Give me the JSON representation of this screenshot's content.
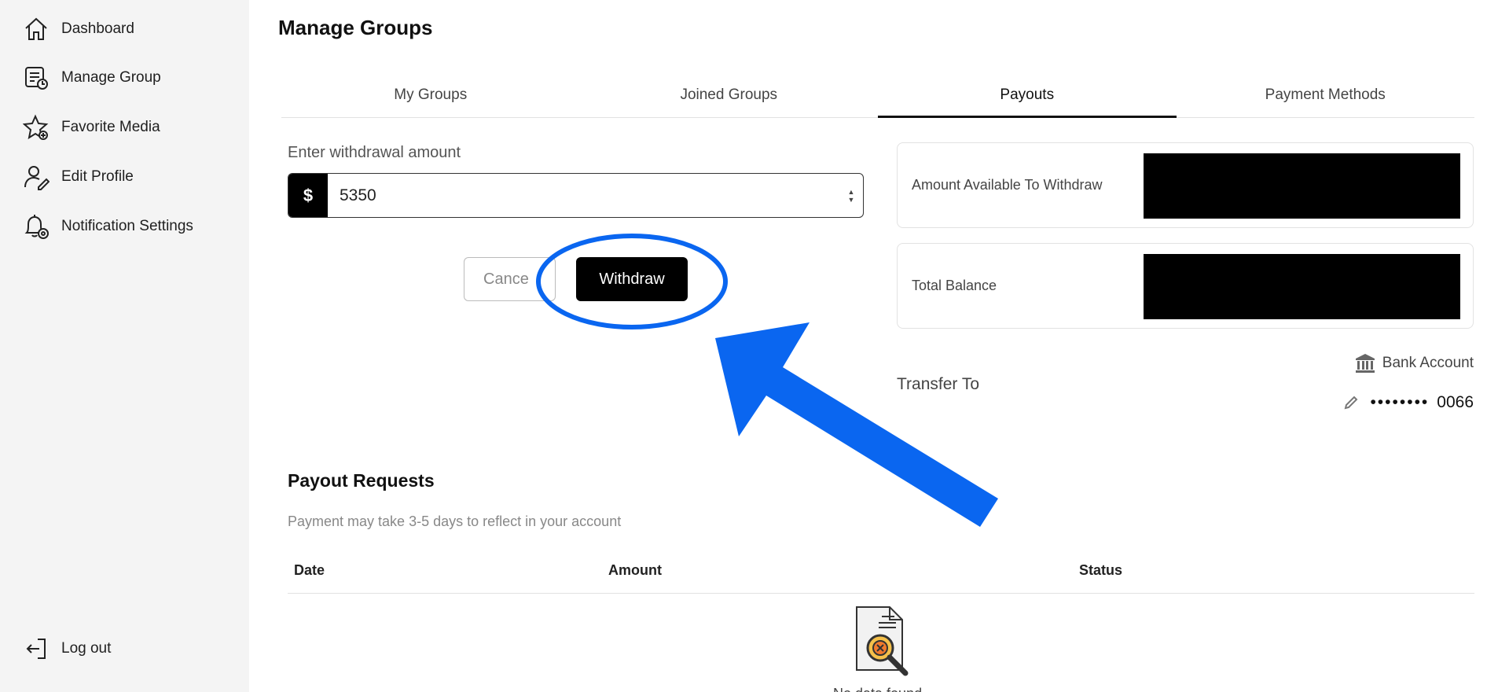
{
  "sidebar": {
    "items": [
      {
        "label": "Dashboard",
        "icon": "home-icon"
      },
      {
        "label": "Manage Group",
        "icon": "manage-group-icon"
      },
      {
        "label": "Favorite Media",
        "icon": "star-icon"
      },
      {
        "label": "Edit Profile",
        "icon": "user-edit-icon"
      },
      {
        "label": "Notification Settings",
        "icon": "bell-settings-icon"
      }
    ],
    "logout_label": "Log out"
  },
  "page": {
    "title": "Manage Groups"
  },
  "tabs": [
    {
      "label": "My Groups",
      "active": false
    },
    {
      "label": "Joined Groups",
      "active": false
    },
    {
      "label": "Payouts",
      "active": true
    },
    {
      "label": "Payment Methods",
      "active": false
    }
  ],
  "withdraw": {
    "label": "Enter withdrawal amount",
    "currency_symbol": "$",
    "amount_value": "5350",
    "cancel_label": "Cance",
    "withdraw_label": "Withdraw"
  },
  "balances": {
    "available_label": "Amount Available To Withdraw",
    "total_label": "Total Balance"
  },
  "transfer": {
    "label": "Transfer To",
    "method_label": "Bank Account",
    "account_mask": "••••••••",
    "account_last4": "0066"
  },
  "payouts": {
    "title": "Payout Requests",
    "note": "Payment may take 3-5 days to reflect in your account",
    "columns": [
      "Date",
      "Amount",
      "Status"
    ],
    "empty_text": "No data found"
  },
  "colors": {
    "accent_black": "#000000",
    "annotation_blue": "#0a66f0",
    "sidebar_bg": "#f4f4f4"
  }
}
